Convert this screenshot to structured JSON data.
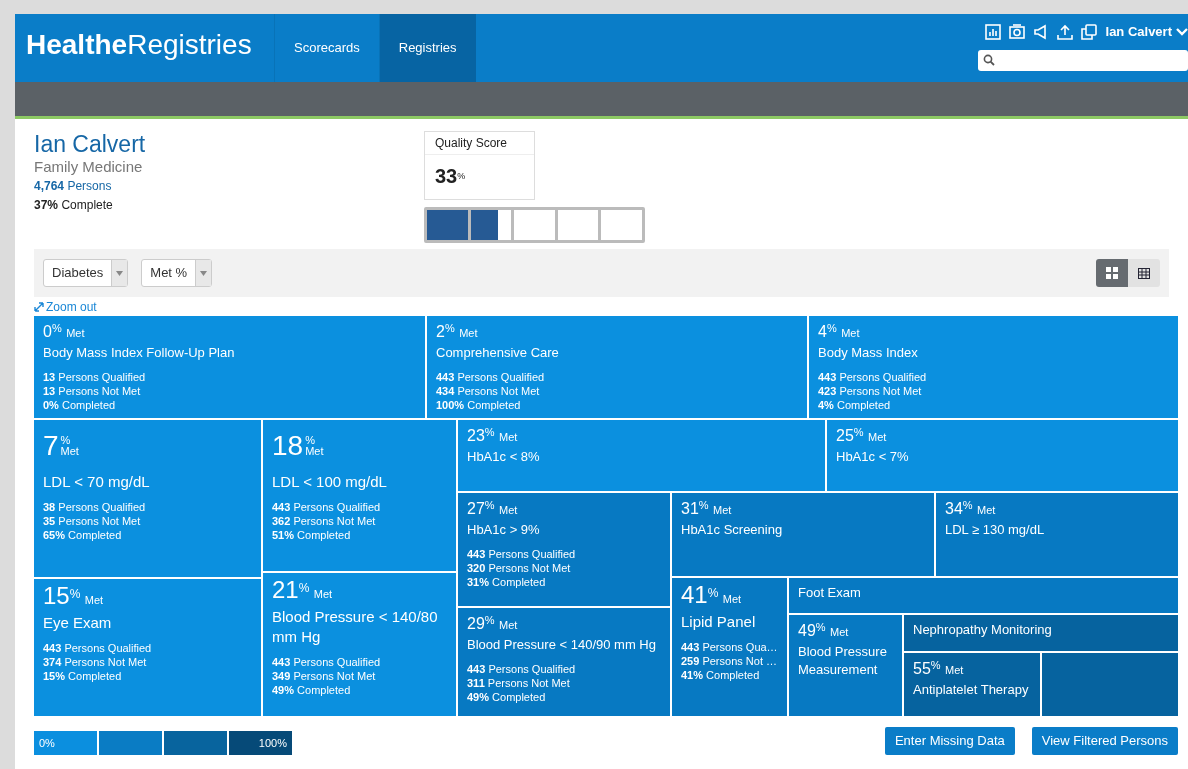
{
  "header": {
    "logo_bold": "Healthe",
    "logo_light": "Registries",
    "nav": [
      {
        "label": "Scorecards",
        "selected": false
      },
      {
        "label": "Registries",
        "selected": true
      }
    ],
    "user": "Ian Calvert"
  },
  "profile": {
    "name": "Ian Calvert",
    "specialty": "Family Medicine",
    "persons_count": "4,764",
    "persons_label": "Persons",
    "complete_value": "37%",
    "complete_label": "Complete"
  },
  "quality_score": {
    "label": "Quality Score",
    "value": "33",
    "unit": "%",
    "level": 0.33
  },
  "filters": {
    "dropdowns": [
      "Diabetes",
      "Met %"
    ],
    "views": [
      {
        "kind": "tiles",
        "selected": true
      },
      {
        "kind": "table",
        "selected": false
      }
    ]
  },
  "zoom_link": "Zoom out",
  "tiles": [
    {
      "kind": "regular",
      "color": "#0b90df",
      "percent": "0",
      "sign": "%",
      "met": "Met",
      "title": "Body Mass Index Follow-Up Plan",
      "stats": [
        "**13** Persons Qualified",
        "**13** Persons Not Met",
        "**0%** Completed"
      ]
    },
    {
      "kind": "regular",
      "color": "#0b90df",
      "percent": "2",
      "sign": "%",
      "met": "Met",
      "title": "Comprehensive Care",
      "stats": [
        "**443** Persons Qualified",
        "**434** Persons Not Met",
        "**100%** Completed"
      ]
    },
    {
      "kind": "regular",
      "color": "#0b90df",
      "percent": "4",
      "sign": "%",
      "met": "Met",
      "title": "Body Mass Index",
      "stats": [
        "**443** Persons Qualified",
        "**423** Persons Not Met",
        "**4%** Completed"
      ]
    },
    {
      "kind": "stacked",
      "color": "#0b90df",
      "percent": "7",
      "sign": "%",
      "met": "Met",
      "title": "LDL < 70 mg/dL",
      "stats": [
        "**38** Persons Qualified",
        "**35** Persons Not Met",
        "**65%** Completed"
      ]
    },
    {
      "kind": "stacked",
      "color": "#0b90df",
      "percent": "18",
      "sign": "%",
      "met": "Met",
      "title": "LDL < 100 mg/dL",
      "stats": [
        "**443** Persons Qualified",
        "**362** Persons Not Met",
        "**51%** Completed"
      ]
    },
    {
      "kind": "regular",
      "color": "#0b90df",
      "percent": "23",
      "sign": "%",
      "met": "Met",
      "title": "HbA1c < 8%"
    },
    {
      "kind": "regular",
      "color": "#0b90df",
      "percent": "25",
      "sign": "%",
      "met": "Met",
      "title": "HbA1c < 7%"
    },
    {
      "kind": "regular",
      "color": "#0779c2",
      "percent": "27",
      "sign": "%",
      "met": "Met",
      "title": "HbA1c > 9%",
      "stats": [
        "**443** Persons Qualified",
        "**320** Persons Not Met",
        "**31%** Completed"
      ]
    },
    {
      "kind": "regular",
      "color": "#0779c2",
      "percent": "31",
      "sign": "%",
      "met": "Met",
      "title": "HbA1c Screening"
    },
    {
      "kind": "regular",
      "color": "#0779c2",
      "percent": "34",
      "sign": "%",
      "met": "Met",
      "title": "LDL ≥ 130 mg/dL"
    },
    {
      "kind": "large",
      "color": "#0b90df",
      "percent": "15",
      "sign": "%",
      "met": "Met",
      "title": "Eye Exam",
      "stats": [
        "**443** Persons Qualified",
        "**374** Persons Not Met",
        "**15%** Completed"
      ]
    },
    {
      "kind": "large",
      "color": "#0b90df",
      "percent": "21",
      "sign": "%",
      "met": "Met",
      "title": "Blood Pressure < 140/80 mm Hg",
      "stats": [
        "**443** Persons Qualified",
        "**349** Persons Not Met",
        "**49%** Completed"
      ]
    },
    {
      "kind": "regular",
      "color": "#0779c2",
      "percent": "29",
      "sign": "%",
      "met": "Met",
      "title": "Blood Pressure < 140/90 mm Hg",
      "stats": [
        "**443** Persons Qualified",
        "**311** Persons Not Met",
        "**49%** Completed"
      ]
    },
    {
      "kind": "large",
      "color": "#0779c2",
      "percent": "41",
      "sign": "%",
      "met": "Met",
      "title": "Lipid Panel",
      "stats": [
        "**443** Persons Qua…",
        "**259** Persons Not …",
        "**41%** Completed"
      ]
    },
    {
      "kind": "title-only",
      "color": "#0779c2",
      "title": "Foot Exam"
    },
    {
      "kind": "regular",
      "color": "#0779c2",
      "percent": "49",
      "sign": "%",
      "met": "Met",
      "title": "Blood Pressure Measurement"
    },
    {
      "kind": "title-only",
      "color": "#06639f",
      "title": "Nephropathy Monitoring"
    },
    {
      "kind": "regular",
      "color": "#06639f",
      "percent": "55",
      "sign": "%",
      "met": "Met",
      "title": "Antiplatelet Therapy"
    },
    {
      "kind": "empty",
      "color": "#06639f"
    }
  ],
  "legend": [
    {
      "label": "0%",
      "color": "#0b8fdf"
    },
    {
      "color": "#0a7cc4"
    },
    {
      "color": "#08649e"
    },
    {
      "label": "100%",
      "color": "#064a78"
    }
  ],
  "buttons": [
    "Enter Missing Data",
    "View Filtered Persons"
  ]
}
